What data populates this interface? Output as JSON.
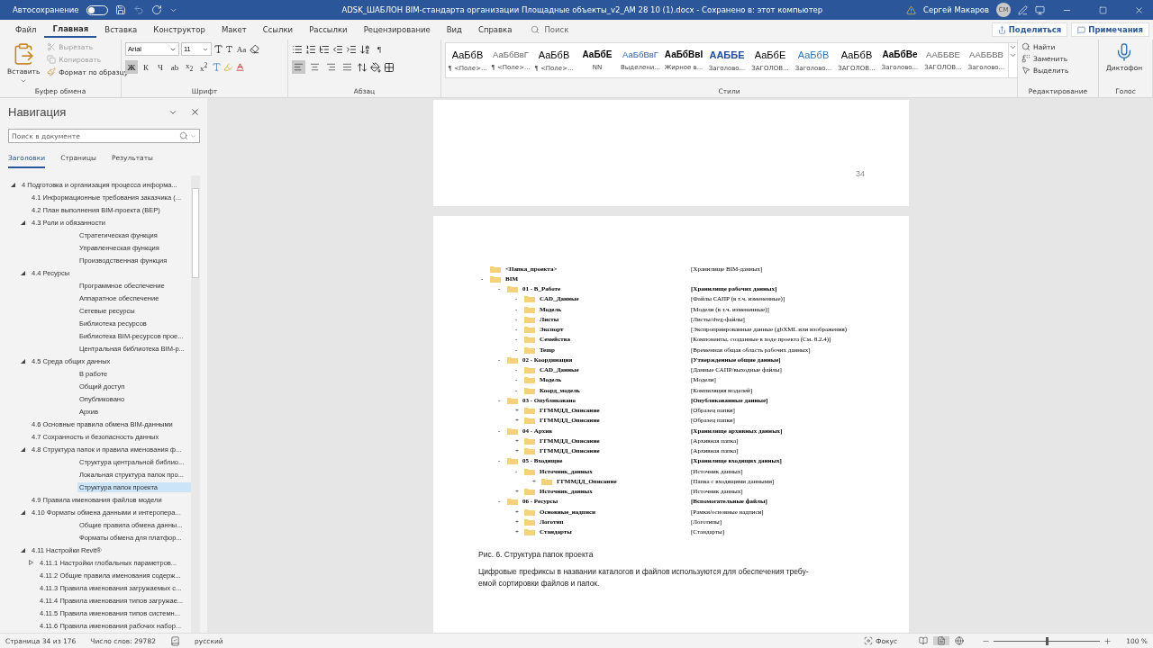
{
  "title_bar": {
    "autosave_label": "Автосохранение",
    "autosave_on": false,
    "title": "ADSK_ШАБЛОН BIM-стандарта организации Площадные объекты_v2_AM 28 10 (1).docx  -  Сохранено в: этот компьютер",
    "user": "Сергей Макаров",
    "initials": "СМ"
  },
  "menu_tabs": [
    {
      "label": "Файл",
      "selected": false
    },
    {
      "label": "Главная",
      "selected": true
    },
    {
      "label": "Вставка",
      "selected": false
    },
    {
      "label": "Конструктор",
      "selected": false
    },
    {
      "label": "Макет",
      "selected": false
    },
    {
      "label": "Ссылки",
      "selected": false
    },
    {
      "label": "Рассылки",
      "selected": false
    },
    {
      "label": "Рецензирование",
      "selected": false
    },
    {
      "label": "Вид",
      "selected": false
    },
    {
      "label": "Справка",
      "selected": false
    }
  ],
  "search": {
    "placeholder": "Поиск"
  },
  "share_button": "Поделиться",
  "comments_button": "Примечания",
  "ribbon": {
    "clipboard": {
      "paste": "Вставить",
      "cut": {
        "label": "Вырезать",
        "disabled": true
      },
      "copy": {
        "label": "Копировать",
        "disabled": true
      },
      "format_painter": {
        "label": "Формат по образцу",
        "disabled": false
      },
      "group_label": "Буфер обмена"
    },
    "font": {
      "font_name": "Arial",
      "font_size": "11",
      "case_button": "Aa",
      "format_buttons": [
        {
          "label": "Ж",
          "selected": true
        },
        {
          "label": "К",
          "selected": false
        },
        {
          "label": "Ч",
          "selected": false
        },
        {
          "label": "ab",
          "selected": false
        },
        {
          "label": "x$_{2}$",
          "selected": false
        },
        {
          "label": "x$^{2}$",
          "selected": false
        }
      ],
      "group_label": "Шрифт"
    },
    "paragraph": {
      "pilcrow": "¶",
      "alignments": [
        {
          "kind": "left",
          "selected": true
        },
        {
          "kind": "center",
          "selected": false
        },
        {
          "kind": "right",
          "selected": false
        },
        {
          "kind": "justify",
          "selected": false
        }
      ],
      "group_label": "Абзац"
    },
    "styles": {
      "items": [
        {
          "preview": "АаБбВ",
          "name": "¶ <Поле>...",
          "kind": "plain"
        },
        {
          "preview": "АаБбВвГ",
          "name": "¶ <Поле>...",
          "kind": "light"
        },
        {
          "preview": "АаБбВ",
          "name": "¶ <Поле>...",
          "kind": "plain"
        },
        {
          "preview": "АаБбЕ",
          "name": "NN",
          "kind": "bold"
        },
        {
          "preview": "АаБбВвГ",
          "name": "Выделени...",
          "kind": "blue-light"
        },
        {
          "preview": "АаБбВвІ",
          "name": "Жирное в...",
          "kind": "bold"
        },
        {
          "preview": "ААББЕ",
          "name": "Заголово...",
          "kind": "heading"
        },
        {
          "preview": "АаБбЕ",
          "name": "ЗАГОЛОВ...",
          "kind": "plain"
        },
        {
          "preview": "АаБбВ",
          "name": "Заголово...",
          "kind": "blue"
        },
        {
          "preview": "АаБбВ",
          "name": "ЗАГОЛОВ...",
          "kind": "plain"
        },
        {
          "preview": "АаБбВе",
          "name": "Заголово...",
          "kind": "bold"
        },
        {
          "preview": "ААББВЕ",
          "name": "ЗАГОЛОВ...",
          "kind": "light"
        },
        {
          "preview": "ААББВВ",
          "name": "Заголово...",
          "kind": "light"
        }
      ],
      "group_label": "Стили"
    },
    "editing": {
      "find": "Найти",
      "replace": "Заменить",
      "select": "Выделить",
      "group_label": "Редактирование"
    },
    "voice": {
      "dictate": "Диктофон",
      "group_label": "Голос"
    }
  },
  "navigation": {
    "title": "Навигация",
    "search_placeholder": "Поиск в документе",
    "tabs": [
      {
        "label": "Заголовки",
        "selected": true
      },
      {
        "label": "Страницы",
        "selected": false
      },
      {
        "label": "Результаты",
        "selected": false
      }
    ],
    "tree": [
      {
        "label": "4 Подготовка и организация процесса информа...",
        "selected": false,
        "expanded": true,
        "children": [
          {
            "label": "4.1 Информационные требования заказчика (...",
            "selected": false
          },
          {
            "label": "4.2 План выполнения BIM-проекта (BEP)",
            "selected": false
          },
          {
            "label": "4.3 Роли и обязанности",
            "selected": false,
            "expanded": true,
            "children": [
              {
                "label": "Стратегическая функция",
                "selected": false,
                "kind": "deep"
              },
              {
                "label": "Управленческая функция",
                "selected": false,
                "kind": "deep"
              },
              {
                "label": "Производственная функция",
                "selected": false,
                "kind": "deep"
              }
            ]
          },
          {
            "label": "4.4 Ресурсы",
            "selected": false,
            "expanded": true,
            "children": [
              {
                "label": "Программное обеспечение",
                "selected": false,
                "kind": "deep"
              },
              {
                "label": "Аппаратное обеспечение",
                "selected": false,
                "kind": "deep"
              },
              {
                "label": "Сетевые ресурсы",
                "selected": false,
                "kind": "deep"
              },
              {
                "label": "Библиотека ресурсов",
                "selected": false,
                "kind": "deep"
              },
              {
                "label": "Библиотека BIM-ресурсов прое...",
                "selected": false,
                "kind": "deep"
              },
              {
                "label": "Центральная библиотека BIM-р...",
                "selected": false,
                "kind": "deep"
              }
            ]
          },
          {
            "label": "4.5 Среда общих данных",
            "selected": false,
            "expanded": true,
            "children": [
              {
                "label": "В работе",
                "selected": false,
                "kind": "deep"
              },
              {
                "label": "Общий доступ",
                "selected": false,
                "kind": "deep"
              },
              {
                "label": "Опубликовано",
                "selected": false,
                "kind": "deep"
              },
              {
                "label": "Архив",
                "selected": false,
                "kind": "deep"
              }
            ]
          },
          {
            "label": "4.6 Основные правила обмена BIM-данными",
            "selected": false
          },
          {
            "label": "4.7 Сохранность и безопасность данных",
            "selected": false
          },
          {
            "label": "4.8 Структура папок и правила именования ф...",
            "selected": false,
            "expanded": true,
            "children": [
              {
                "label": "Структура центральной библио...",
                "selected": false,
                "kind": "deep"
              },
              {
                "label": "Локальная структура папок про...",
                "selected": false,
                "kind": "deep"
              },
              {
                "label": "Структура папок проекта",
                "selected": true,
                "kind": "deep"
              }
            ]
          },
          {
            "label": "4.9 Правила именования файлов модели",
            "selected": false
          },
          {
            "label": "4.10 Форматы обмена данными и интеропера...",
            "selected": false,
            "expanded": true,
            "children": [
              {
                "label": "Общие правила обмена данны...",
                "selected": false,
                "kind": "deep"
              },
              {
                "label": "Форматы обмена для платфор...",
                "selected": false,
                "kind": "deep"
              }
            ]
          },
          {
            "label": "4.11 Настройки Revit®",
            "selected": false,
            "expanded": true,
            "children": [
              {
                "label": "4.11.1 Настройки глобальных параметров...",
                "selected": false,
                "expanded": false,
                "kind": "near"
              },
              {
                "label": "4.11.2 Общие правила именования содерж...",
                "selected": false,
                "kind": "near"
              },
              {
                "label": "4.11.3 Правила именования загружаемых с...",
                "selected": false,
                "kind": "near"
              },
              {
                "label": "4.11.4 Правила именования типов загружае...",
                "selected": false,
                "kind": "near"
              },
              {
                "label": "4.11.5 Правила именования типов системн...",
                "selected": false,
                "kind": "near"
              },
              {
                "label": "4.11.6 Правила именования рабочих набор...",
                "selected": false,
                "kind": "near"
              }
            ]
          }
        ]
      }
    ]
  },
  "document": {
    "page_number": "34",
    "folder_tree": [
      {
        "name": "<Папка_проекта>",
        "description": "[Хранилище BIM-данных]"
      },
      {
        "sign": "-",
        "name": "BIM",
        "children": [
          {
            "sign": "-",
            "name": "01 - В_Работе",
            "description": "[Хранилище рабочих данных]",
            "children": [
              {
                "sign": "-",
                "name": "CAD_Данные",
                "description": "[Файлы САПР (в т.ч. измененные)]"
              },
              {
                "sign": "-",
                "name": "Модель",
                "description": "[Модели (в т.ч. измененные)]"
              },
              {
                "sign": "-",
                "name": "Листы",
                "description": "[Листы/dwg-файлы]"
              },
              {
                "sign": "-",
                "name": "Экспорт",
                "description": "[Экспроприированные  данные (gbXML или изображения)"
              },
              {
                "sign": "-",
                "name": "Семейства",
                "description": "[Компоненты, созданные в ходе проекта (См. 8.2.4)]"
              },
              {
                "sign": "-",
                "name": "Temp",
                "description": "[Временная общая область рабочих данных]"
              }
            ]
          },
          {
            "sign": "-",
            "name": "02 - Координация",
            "description": "[Утвержденные общие данные]",
            "children": [
              {
                "sign": "-",
                "name": "CAD_Данные",
                "description": "[Данные САПР/выходные файлы]"
              },
              {
                "sign": "-",
                "name": "Модель",
                "description": "[Модели]"
              },
              {
                "sign": "-",
                "name": "Коорд_модель",
                "description": "[Компиляция  моделей]"
              }
            ]
          },
          {
            "sign": "-",
            "name": "03 - Опубликовано",
            "description": "[Опубликованные данные]",
            "children": [
              {
                "sign": "+",
                "name": "ГГММДД_Описание",
                "description": "[Образец папки]"
              },
              {
                "sign": "+",
                "name": "ГГММДД_Описание",
                "description": "[Образец папки]"
              }
            ]
          },
          {
            "sign": "-",
            "name": "04 - Архив",
            "description": "[Хранилище архивных данных]",
            "children": [
              {
                "sign": "+",
                "name": "ГГММДД_Описание",
                "description": "[Архивная  папка]"
              },
              {
                "sign": "+",
                "name": "ГГММДД_Описание",
                "description": "[Архивная  папка]"
              }
            ]
          },
          {
            "sign": "-",
            "name": "05 - Входящие",
            "description": "[Хранилище входящих данных]",
            "children": [
              {
                "sign": "-",
                "name": "Источник_данных",
                "description": "[Источник данных]",
                "children": [
                  {
                    "sign": "+",
                    "name": "ГГММДД_Описание",
                    "description": "[Папка с входящими данными]"
                  }
                ]
              },
              {
                "sign": "+",
                "name": "Источник_данных",
                "description": "[Источник данных]"
              }
            ]
          },
          {
            "sign": "-",
            "name": "06 - Ресурсы",
            "description": "[Вспомогательные файлы]",
            "children": [
              {
                "sign": "+",
                "name": "Основные_надписи",
                "description": "[Рамки/основные надписи]"
              },
              {
                "sign": "+",
                "name": "Логотип",
                "description": "[Логотипы]"
              },
              {
                "sign": "+",
                "name": "Стандарты",
                "description": "[Стандарты]"
              }
            ]
          }
        ]
      }
    ],
    "caption": "Рис. 6. Структура папок проекта",
    "paragraph": "Цифровые префиксы в названии каталогов и файлов используются для обеспечения требу-\nемой сортировки файлов и папок."
  },
  "status_bar": {
    "page": "Страница 34 из 176",
    "words": "Число слов: 29782",
    "language": "русский",
    "focus": "Фокус",
    "views": [
      {
        "kind": "read",
        "selected": false
      },
      {
        "kind": "print",
        "selected": true
      },
      {
        "kind": "web",
        "selected": false
      }
    ],
    "zoom": {
      "level": 0.5,
      "label": "100 %"
    }
  }
}
